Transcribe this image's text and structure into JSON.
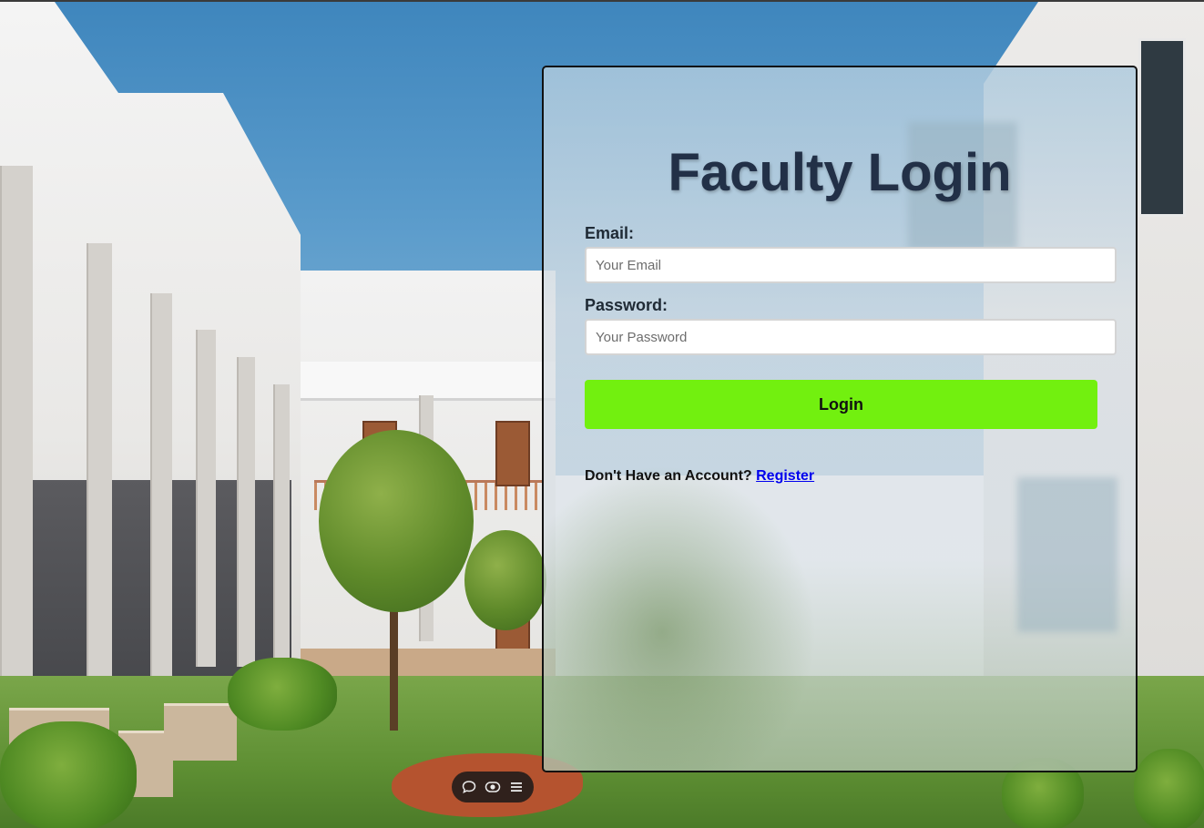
{
  "login": {
    "title": "Faculty Login",
    "email_label": "Email:",
    "email_placeholder": "Your Email",
    "email_value": "",
    "password_label": "Password:",
    "password_placeholder": "Your Password",
    "password_value": "",
    "submit_label": "Login",
    "account_prompt": "Don't Have an Account?",
    "register_link": "Register"
  },
  "toolbar": {
    "icons": [
      "chat-bubble-icon",
      "eye-toggle-icon",
      "hamburger-menu-icon"
    ]
  },
  "colors": {
    "title": "#223047",
    "button": "#72f00f",
    "link": "#0000ee",
    "card_border": "#111111"
  }
}
